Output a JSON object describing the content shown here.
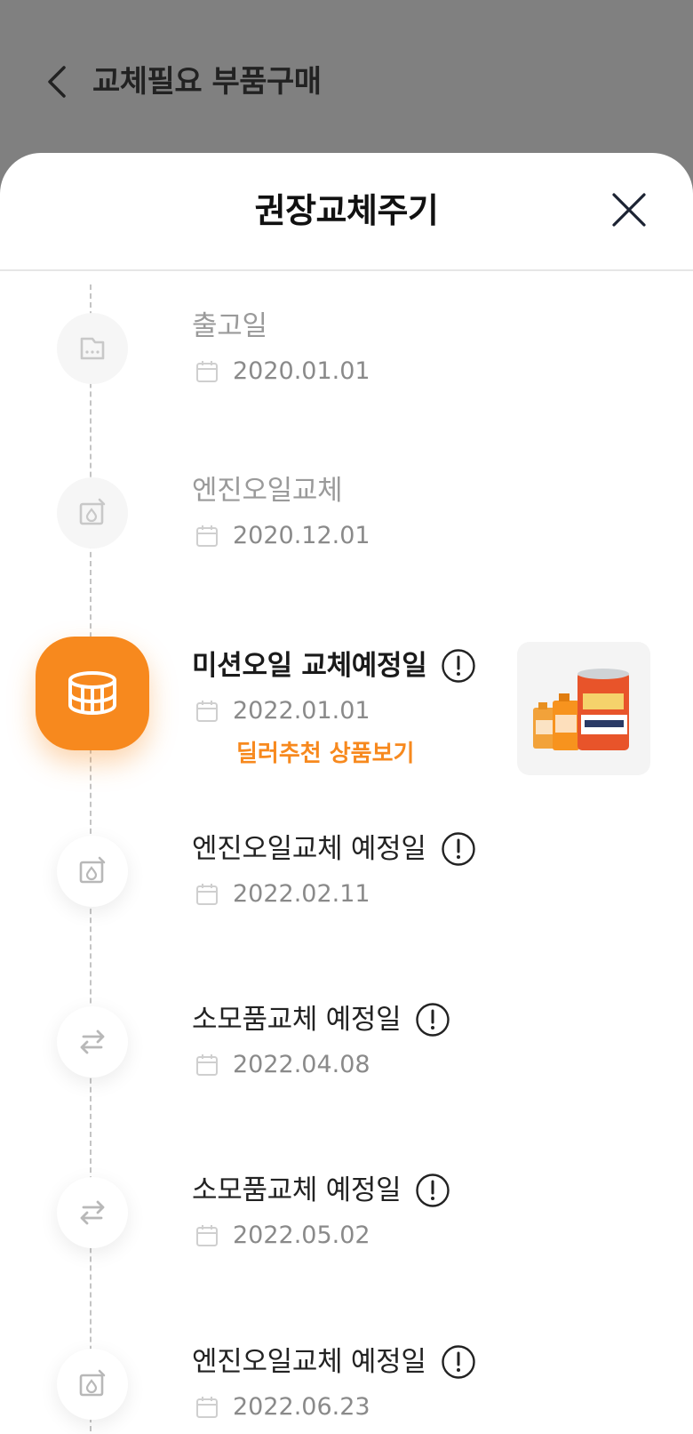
{
  "header": {
    "title": "교체필요 부품구매"
  },
  "sheet": {
    "title": "권장교체주기"
  },
  "timeline": [
    {
      "title": "출고일",
      "date": "2020.01.01",
      "icon": "document-icon",
      "state": "past"
    },
    {
      "title": "엔진오일교체",
      "date": "2020.12.01",
      "icon": "engine-oil-icon",
      "state": "past"
    },
    {
      "title": "미션오일 교체예정일",
      "date": "2022.01.01",
      "icon": "transmission-oil-icon",
      "state": "active",
      "link": "딜러추천 상품보기",
      "product_image": "oil-products-image"
    },
    {
      "title": "엔진오일교체 예정일",
      "date": "2022.02.11",
      "icon": "engine-oil-icon",
      "state": "upcoming"
    },
    {
      "title": "소모품교체 예정일",
      "date": "2022.04.08",
      "icon": "exchange-icon",
      "state": "upcoming"
    },
    {
      "title": "소모품교체 예정일",
      "date": "2022.05.02",
      "icon": "exchange-icon",
      "state": "upcoming"
    },
    {
      "title": "엔진오일교체 예정일",
      "date": "2022.06.23",
      "icon": "engine-oil-icon",
      "state": "upcoming"
    }
  ],
  "colors": {
    "accent": "#f7891e",
    "overlay": "#808080"
  }
}
